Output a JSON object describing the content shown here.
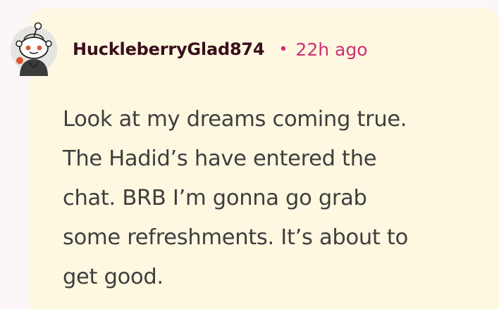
{
  "comment": {
    "author": "HuckleberryGlad874",
    "separator": "•",
    "timestamp": "22h ago",
    "body_lines": [
      "Look at my dreams coming true.",
      "The Hadid’s have entered the",
      "chat. BRB I’m gonna go grab",
      "some refreshments. It’s about to",
      "get good."
    ],
    "avatar_icon": "snoo-avatar-icon"
  },
  "colors": {
    "page_background": "#fdf6f9",
    "card_background": "#fef8e1",
    "author_color": "#3a0f1c",
    "timestamp_color": "#cf2f74",
    "body_text_color": "#3e3e3e"
  }
}
